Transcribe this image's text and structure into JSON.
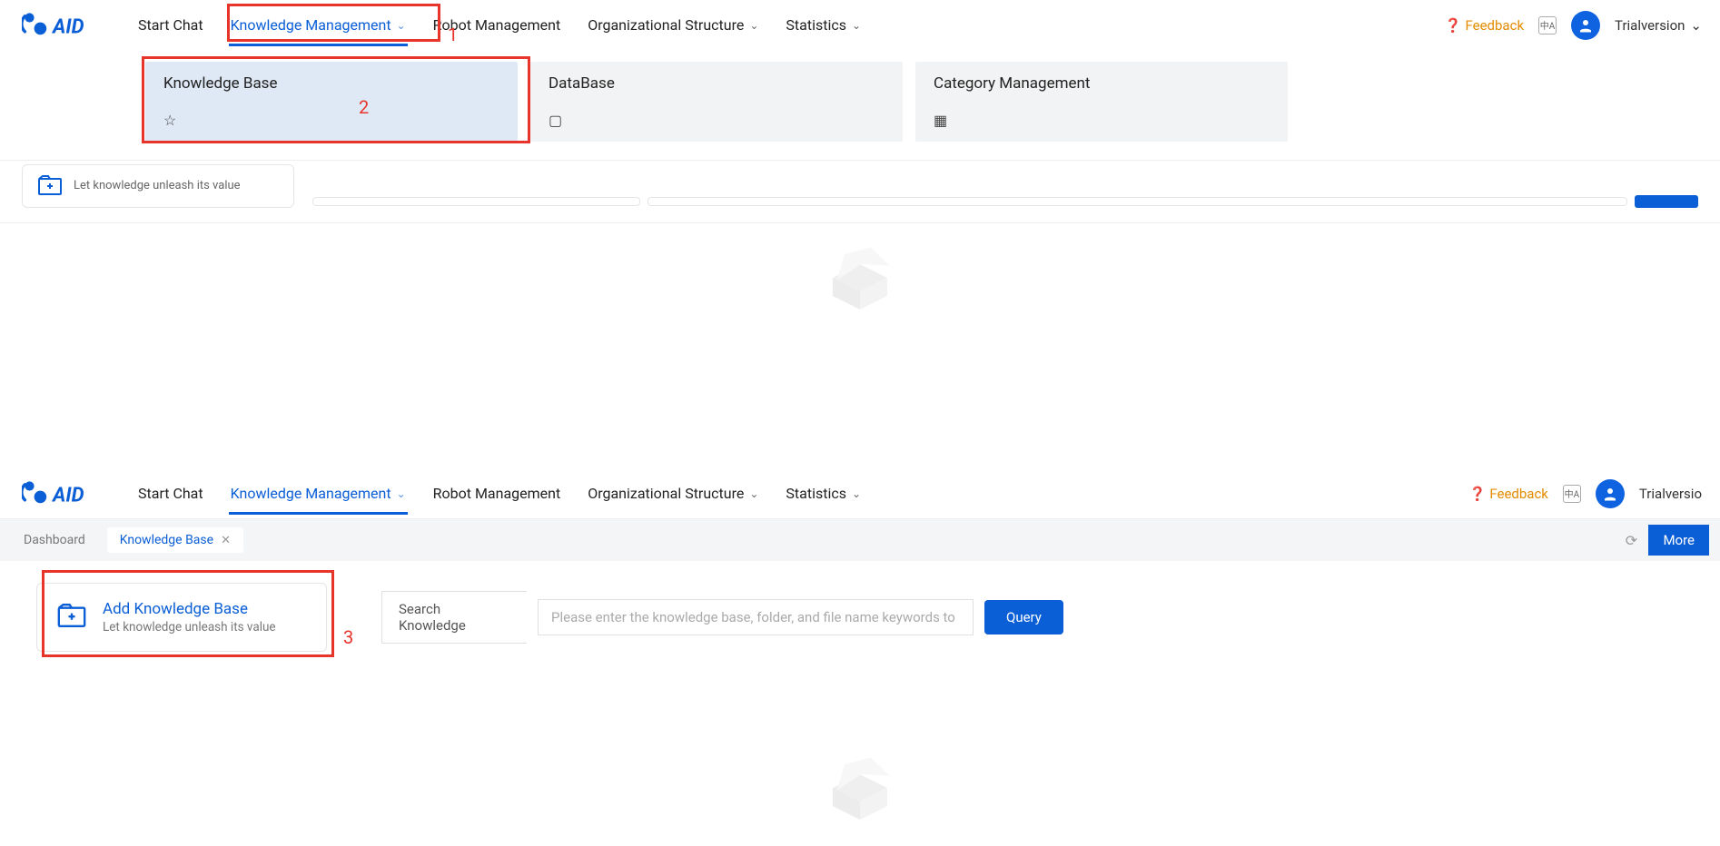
{
  "nav": {
    "items": [
      {
        "label": "Start Chat"
      },
      {
        "label": "Knowledge Management"
      },
      {
        "label": "Robot Management"
      },
      {
        "label": "Organizational Structure"
      },
      {
        "label": "Statistics"
      }
    ],
    "feedback": "Feedback",
    "user": "Trialversion"
  },
  "mega": {
    "cards": [
      {
        "title": "Knowledge Base"
      },
      {
        "title": "DataBase"
      },
      {
        "title": "Category Management"
      }
    ]
  },
  "peek": {
    "subtitle": "Let knowledge unleash its value"
  },
  "tabs": {
    "dashboard": "Dashboard",
    "kb": "Knowledge Base"
  },
  "add_card": {
    "title": "Add Knowledge Base",
    "subtitle": "Let knowledge unleash its value"
  },
  "search": {
    "label": "Search Knowledge",
    "placeholder": "Please enter the knowledge base, folder, and file name keywords to",
    "query": "Query"
  },
  "more": "More",
  "annotations": {
    "n1": "1",
    "n2": "2",
    "n3": "3"
  },
  "nav2_user": "Trialversio"
}
